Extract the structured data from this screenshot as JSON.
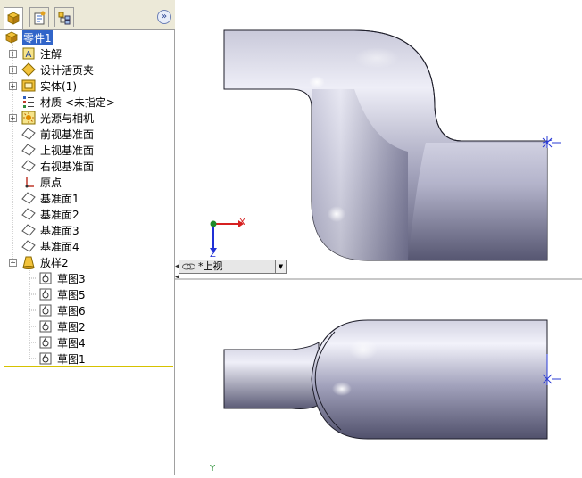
{
  "tabs": [
    {
      "name": "feature-manager-tab",
      "icon": "feature-tree-icon"
    },
    {
      "name": "property-manager-tab",
      "icon": "property-icon"
    },
    {
      "name": "configuration-manager-tab",
      "icon": "configuration-icon"
    }
  ],
  "tree": {
    "root": "零件1",
    "items": [
      {
        "label": "注解",
        "expandable": true,
        "icon": "annotation-icon"
      },
      {
        "label": "设计活页夹",
        "expandable": true,
        "icon": "design-binder-icon"
      },
      {
        "label": "实体(1)",
        "expandable": true,
        "icon": "solid-body-icon"
      },
      {
        "label": "材质 <未指定>",
        "expandable": false,
        "icon": "material-icon"
      },
      {
        "label": "光源与相机",
        "expandable": true,
        "icon": "lights-camera-icon"
      },
      {
        "label": "前视基准面",
        "expandable": false,
        "icon": "plane-icon"
      },
      {
        "label": "上视基准面",
        "expandable": false,
        "icon": "plane-icon"
      },
      {
        "label": "右视基准面",
        "expandable": false,
        "icon": "plane-icon"
      },
      {
        "label": "原点",
        "expandable": false,
        "icon": "origin-icon"
      },
      {
        "label": "基准面1",
        "expandable": false,
        "icon": "plane-icon"
      },
      {
        "label": "基准面2",
        "expandable": false,
        "icon": "plane-icon"
      },
      {
        "label": "基准面3",
        "expandable": false,
        "icon": "plane-icon"
      },
      {
        "label": "基准面4",
        "expandable": false,
        "icon": "plane-icon"
      },
      {
        "label": "放样2",
        "expandable": true,
        "expanded": true,
        "icon": "loft-icon"
      }
    ],
    "sketches": [
      "草图3",
      "草图5",
      "草图6",
      "草图2",
      "草图4",
      "草图1"
    ]
  },
  "viewport": {
    "view_name": "*上视",
    "axis_x": "X",
    "axis_z": "Z",
    "axis_y": "Y"
  },
  "colors": {
    "selection": "#3165c9",
    "model_light": "#e6e6f2",
    "model_dark": "#4d4d66",
    "tree_end_line": "#d6c200"
  }
}
